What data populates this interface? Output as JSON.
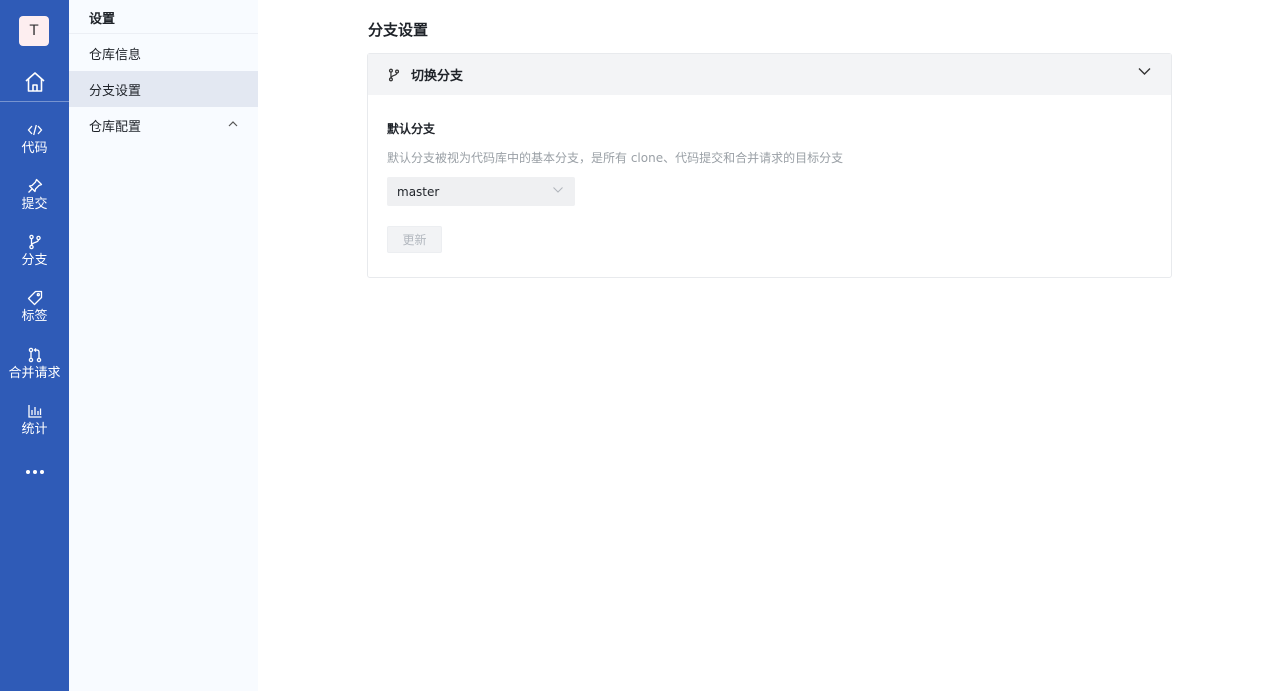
{
  "rail": {
    "avatar_letter": "T",
    "items": [
      {
        "label": "代码",
        "icon": "code-icon"
      },
      {
        "label": "提交",
        "icon": "pin-icon"
      },
      {
        "label": "分支",
        "icon": "branch-icon"
      },
      {
        "label": "标签",
        "icon": "tag-icon"
      },
      {
        "label": "合并请求",
        "icon": "merge-request-icon"
      },
      {
        "label": "统计",
        "icon": "bar-chart-icon"
      }
    ]
  },
  "subnav": {
    "title": "设置",
    "items": [
      {
        "label": "仓库信息",
        "active": false
      },
      {
        "label": "分支设置",
        "active": true
      },
      {
        "label": "仓库配置",
        "active": false,
        "expandable": true
      }
    ]
  },
  "main": {
    "page_title": "分支设置",
    "panel": {
      "title": "切换分支",
      "section_label": "默认分支",
      "section_desc": "默认分支被视为代码库中的基本分支，是所有 clone、代码提交和合并请求的目标分支",
      "select_value": "master",
      "update_label": "更新"
    }
  },
  "colors": {
    "rail_bg": "#2f5bb7",
    "subnav_bg": "#f8fbff",
    "active_item_bg": "#e3e8f2"
  }
}
